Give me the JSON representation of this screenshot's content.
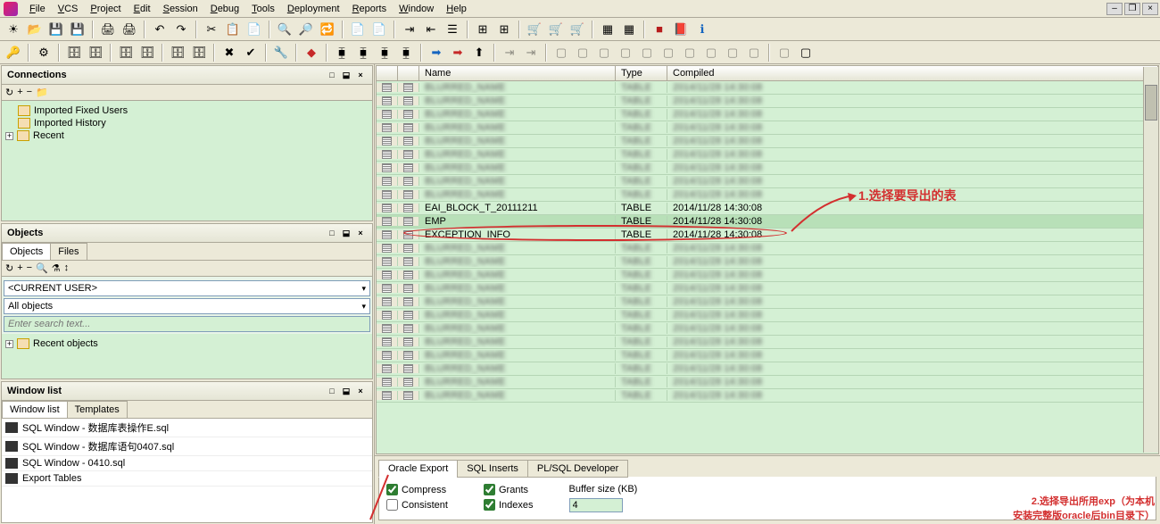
{
  "menu": {
    "items": [
      "File",
      "VCS",
      "Project",
      "Edit",
      "Session",
      "Debug",
      "Tools",
      "Deployment",
      "Reports",
      "Window",
      "Help"
    ]
  },
  "panels": {
    "connections": {
      "title": "Connections",
      "items": [
        "Imported Fixed Users",
        "Imported History",
        "Recent"
      ]
    },
    "objects": {
      "title": "Objects",
      "tabs": [
        "Objects",
        "Files"
      ],
      "currentUser": "<CURRENT USER>",
      "allObjects": "All objects",
      "searchPlaceholder": "Enter search text...",
      "recent": "Recent objects"
    },
    "windowlist": {
      "title": "Window list",
      "tabs": [
        "Window list",
        "Templates"
      ],
      "items": [
        "SQL Window - 数据库表操作E.sql",
        "SQL Window - 数据库语句0407.sql",
        "SQL Window - 0410.sql",
        "Export Tables"
      ]
    }
  },
  "grid": {
    "headers": {
      "name": "Name",
      "type": "Type",
      "compiled": "Compiled"
    },
    "rows": [
      {
        "name": "BLURRED_NAME",
        "type": "TABLE",
        "compiled": "2014/11/28 14:30:08",
        "blur": true
      },
      {
        "name": "BLURRED_NAME",
        "type": "TABLE",
        "compiled": "2014/11/28 14:30:08",
        "blur": true
      },
      {
        "name": "BLURRED_NAME",
        "type": "TABLE",
        "compiled": "2014/11/28 14:30:08",
        "blur": true
      },
      {
        "name": "BLURRED_NAME",
        "type": "TABLE",
        "compiled": "2014/11/28 14:30:08",
        "blur": true
      },
      {
        "name": "BLURRED_NAME",
        "type": "TABLE",
        "compiled": "2014/11/28 14:30:08",
        "blur": true
      },
      {
        "name": "BLURRED_NAME",
        "type": "TABLE",
        "compiled": "2014/11/28 14:30:08",
        "blur": true
      },
      {
        "name": "BLURRED_NAME",
        "type": "TABLE",
        "compiled": "2014/11/28 14:30:08",
        "blur": true
      },
      {
        "name": "BLURRED_NAME",
        "type": "TABLE",
        "compiled": "2014/11/28 14:30:08",
        "blur": true
      },
      {
        "name": "BLURRED_NAME",
        "type": "TABLE",
        "compiled": "2014/11/28 14:30:08",
        "blur": true
      },
      {
        "name": "EAI_BLOCK_T_20111211",
        "type": "TABLE",
        "compiled": "2014/11/28 14:30:08",
        "blur": false
      },
      {
        "name": "EMP",
        "type": "TABLE",
        "compiled": "2014/11/28 14:30:08",
        "blur": false,
        "hl": true
      },
      {
        "name": "EXCEPTION_INFO",
        "type": "TABLE",
        "compiled": "2014/11/28 14:30:08",
        "blur": false
      },
      {
        "name": "BLURRED_NAME",
        "type": "TABLE",
        "compiled": "2014/11/28 14:30:08",
        "blur": true
      },
      {
        "name": "BLURRED_NAME",
        "type": "TABLE",
        "compiled": "2014/11/28 14:30:08",
        "blur": true
      },
      {
        "name": "BLURRED_NAME",
        "type": "TABLE",
        "compiled": "2014/11/28 14:30:08",
        "blur": true
      },
      {
        "name": "BLURRED_NAME",
        "type": "TABLE",
        "compiled": "2014/11/28 14:30:08",
        "blur": true
      },
      {
        "name": "BLURRED_NAME",
        "type": "TABLE",
        "compiled": "2014/11/28 14:30:08",
        "blur": true
      },
      {
        "name": "BLURRED_NAME",
        "type": "TABLE",
        "compiled": "2014/11/28 14:30:08",
        "blur": true
      },
      {
        "name": "BLURRED_NAME",
        "type": "TABLE",
        "compiled": "2014/11/28 14:30:08",
        "blur": true
      },
      {
        "name": "BLURRED_NAME",
        "type": "TABLE",
        "compiled": "2014/11/28 14:30:08",
        "blur": true
      },
      {
        "name": "BLURRED_NAME",
        "type": "TABLE",
        "compiled": "2014/11/28 14:30:08",
        "blur": true
      },
      {
        "name": "BLURRED_NAME",
        "type": "TABLE",
        "compiled": "2014/11/28 14:30:08",
        "blur": true
      },
      {
        "name": "BLURRED_NAME",
        "type": "TABLE",
        "compiled": "2014/11/28 14:30:08",
        "blur": true
      },
      {
        "name": "BLURRED_NAME",
        "type": "TABLE",
        "compiled": "2014/11/28 14:30:08",
        "blur": true
      }
    ]
  },
  "export": {
    "tabs": [
      "Oracle Export",
      "SQL Inserts",
      "PL/SQL Developer"
    ],
    "compress": "Compress",
    "consistent": "Consistent",
    "grants": "Grants",
    "indexes": "Indexes",
    "bufferLabel": "Buffer size (KB)",
    "bufferValue": "4"
  },
  "annotations": {
    "a1": "1.选择要导出的表",
    "a2": "2.选择导出所用exp（为本机\n安装完整版oracle后bin目录下）"
  }
}
